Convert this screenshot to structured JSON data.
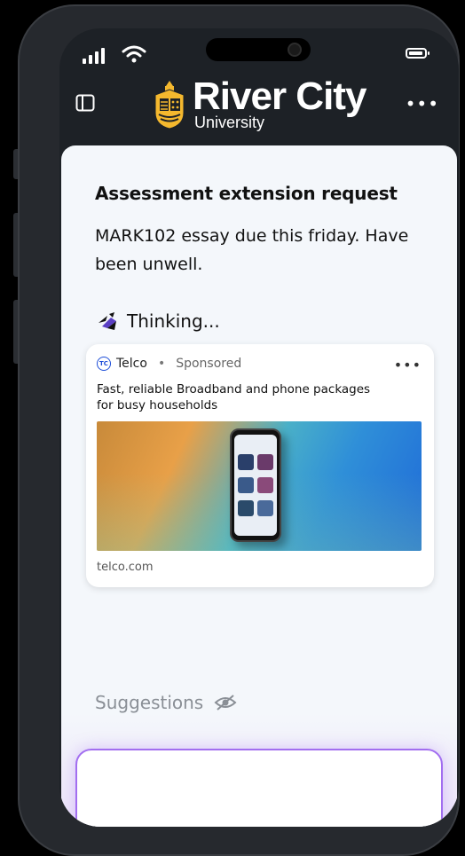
{
  "brand": {
    "name": "River City",
    "subtitle": "University"
  },
  "request": {
    "title": "Assessment extension request",
    "body": "MARK102 essay due this friday. Have been unwell."
  },
  "status": {
    "thinking": "Thinking..."
  },
  "ad": {
    "advertiser": "Telco",
    "logo_text": "TC",
    "separator": "•",
    "sponsored": "Sponsored",
    "text": "Fast, reliable Broadband and phone packages for busy households",
    "url": "telco.com",
    "more": "•••"
  },
  "suggestions": {
    "label": "Suggestions"
  },
  "topbar": {
    "more": "•••"
  },
  "colors": {
    "accent": "#a26ef0",
    "card": "#ffffff",
    "background": "#1d2126"
  }
}
